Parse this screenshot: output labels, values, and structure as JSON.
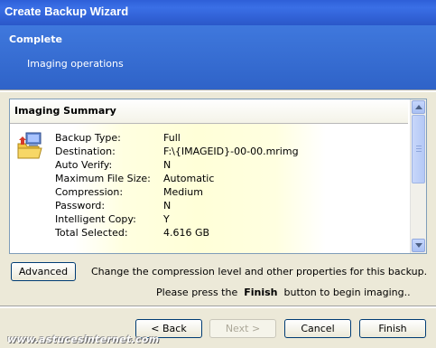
{
  "window": {
    "title": "Create Backup Wizard"
  },
  "header": {
    "title": "Complete",
    "subtitle": "Imaging operations"
  },
  "summary": {
    "heading": "Imaging Summary",
    "rows": [
      {
        "key": "Backup Type:",
        "value": "Full"
      },
      {
        "key": "Destination:",
        "value": "F:\\{IMAGEID}-00-00.mrimg"
      },
      {
        "key": "Auto Verify:",
        "value": "N"
      },
      {
        "key": "Maximum File Size:",
        "value": "Automatic"
      },
      {
        "key": "Compression:",
        "value": "Medium"
      },
      {
        "key": "Password:",
        "value": "N"
      },
      {
        "key": "Intelligent Copy:",
        "value": "Y"
      },
      {
        "key": "Total Selected:",
        "value": "4.616 GB"
      }
    ]
  },
  "advanced": {
    "button_label": "Advanced",
    "description": "Change the compression level and other properties for this backup."
  },
  "instruction": {
    "prefix": "Please press the",
    "emphasis": "Finish",
    "suffix": "button to begin imaging.."
  },
  "buttons": {
    "back": "< Back",
    "next": "Next >",
    "cancel": "Cancel",
    "finish": "Finish"
  },
  "watermark": "www.astucesinternet.com",
  "icons": {
    "backup": "backup-icon",
    "scroll_up": "scroll-up-arrow-icon",
    "scroll_down": "scroll-down-arrow-icon"
  },
  "colors": {
    "header_blue": "#2f63c8",
    "title_blue": "#2e5fd8"
  }
}
